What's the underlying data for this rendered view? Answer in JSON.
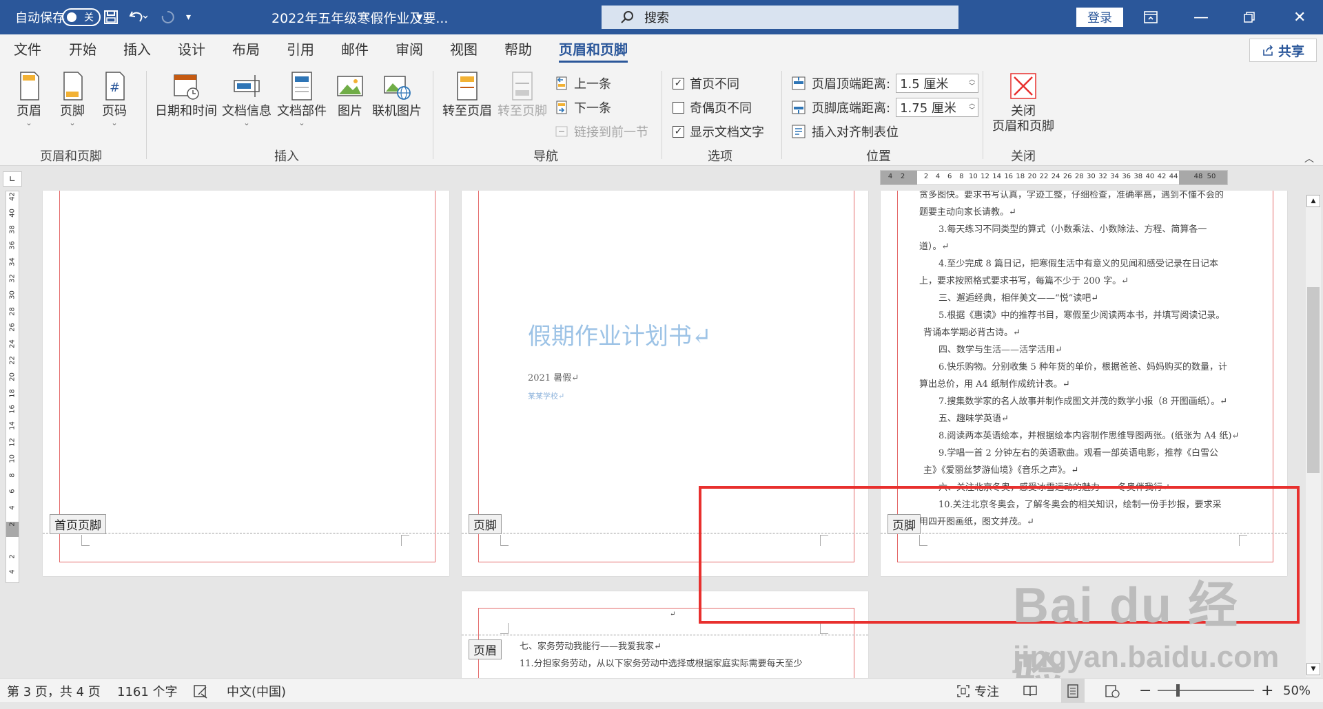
{
  "titlebar": {
    "autosave_label": "自动保存",
    "autosave_state": "关",
    "doc_title": "2022年五年级寒假作业及要...",
    "search_placeholder": "搜索",
    "login_label": "登录"
  },
  "menu": {
    "tabs": [
      "文件",
      "开始",
      "插入",
      "设计",
      "布局",
      "引用",
      "邮件",
      "审阅",
      "视图",
      "帮助",
      "页眉和页脚"
    ],
    "active": "页眉和页脚",
    "share_label": "共享"
  },
  "ribbon": {
    "header_footer": {
      "header": "页眉",
      "footer": "页脚",
      "page_number": "页码",
      "group": "页眉和页脚"
    },
    "insert": {
      "datetime": "日期和时间",
      "docinfo": "文档信息",
      "docparts": "文档部件",
      "picture": "图片",
      "online_picture": "联机图片",
      "group": "插入"
    },
    "nav": {
      "goto_header": "转至页眉",
      "goto_footer": "转至页脚",
      "previous": "上一条",
      "next": "下一条",
      "link_previous": "链接到前一节",
      "group": "导航"
    },
    "options": {
      "first_page": "首页不同",
      "odd_even": "奇偶页不同",
      "show_text": "显示文档文字",
      "group": "选项"
    },
    "position": {
      "header_top": "页眉顶端距离:",
      "header_top_value": "1.5 厘米",
      "footer_bottom": "页脚底端距离:",
      "footer_bottom_value": "1.75 厘米",
      "insert_tab": "插入对齐制表位",
      "group": "位置"
    },
    "close": {
      "label_line1": "关闭",
      "label_line2": "页眉和页脚",
      "group": "关闭"
    }
  },
  "ruler": {
    "h_left": [
      "4",
      "2"
    ],
    "h_main": [
      "2",
      "4",
      "6",
      "8",
      "10",
      "12",
      "14",
      "16",
      "18",
      "20",
      "22",
      "24",
      "26",
      "28",
      "30",
      "32",
      "34",
      "36",
      "38",
      "40",
      "42",
      "44"
    ],
    "h_right": [
      "48",
      "50"
    ],
    "v_ticks": [
      "42",
      "40",
      "38",
      "36",
      "34",
      "32",
      "30",
      "28",
      "26",
      "24",
      "22",
      "20",
      "18",
      "16",
      "14",
      "12",
      "10",
      "8",
      "6",
      "4",
      "2"
    ],
    "v_bottom": [
      "2",
      "4"
    ]
  },
  "pages": {
    "first_footer_tag": "首页页脚",
    "footer_tag": "页脚",
    "header_tag": "页眉",
    "title": "假期作业计划书↵",
    "subtitle1": "2021 暑假↵",
    "subtitle2": "某某学校↵",
    "p3_lines": [
      "贪多图快。要求书写认真，字迹工整，仔细检查，准确率高，遇到不懂不会的",
      "题要主动向家长请教。↵",
      "3.每天练习不同类型的算式（小数乘法、小数除法、方程、简算各一",
      "道）。↵",
      "4.至少完成 8 篇日记，把寒假生活中有意义的见闻和感受记录在日记本",
      "上，要求按照格式要求书写，每篇不少于 200 字。↵",
      "三、邂逅经典，相伴美文——“悦”读吧↵",
      "5.根据《惠读》中的推荐书目，寒假至少阅读两本书，并填写阅读记录。",
      "背诵本学期必背古诗。↵",
      "四、数学与生活——活学活用↵",
      "6.快乐购物。分别收集 5 种年货的单价，根据爸爸、妈妈购买的数量，计",
      "算出总价，用 A4 纸制作成统计表。↵",
      "7.搜集数学家的名人故事并制作成图文并茂的数学小报（8 开图画纸）。↵",
      "五、趣味学英语↵",
      "8.阅读两本英语绘本，并根据绘本内容制作思维导图两张。(纸张为 A4 纸)↵",
      "9.学唱一首 2 分钟左右的英语歌曲。观看一部英语电影，推荐《白雪公",
      "主》《爱丽丝梦游仙境》《音乐之声》。↵",
      "六、关注北京冬奥，感受冰雪运动的魅力——冬奥伴我行↵",
      "10.关注北京冬奥会，了解冬奥会的相关知识，绘制一份手抄报，要求采",
      "用四开图画纸，图文并茂。↵"
    ],
    "p4_header_mark": "↵",
    "p4_lines": [
      "七、家务劳动我能行——我爱我家↵",
      "11.分担家务劳动，从以下家务劳动中选择或根据家庭实际需要每天至少"
    ]
  },
  "watermark": {
    "big": "Bai du 经验",
    "small": "jingyan.baidu.com"
  },
  "status": {
    "page": "第 3 页，共 4 页",
    "words": "1161 个字",
    "language": "中文(中国)",
    "focus": "专注",
    "zoom": "50%"
  }
}
